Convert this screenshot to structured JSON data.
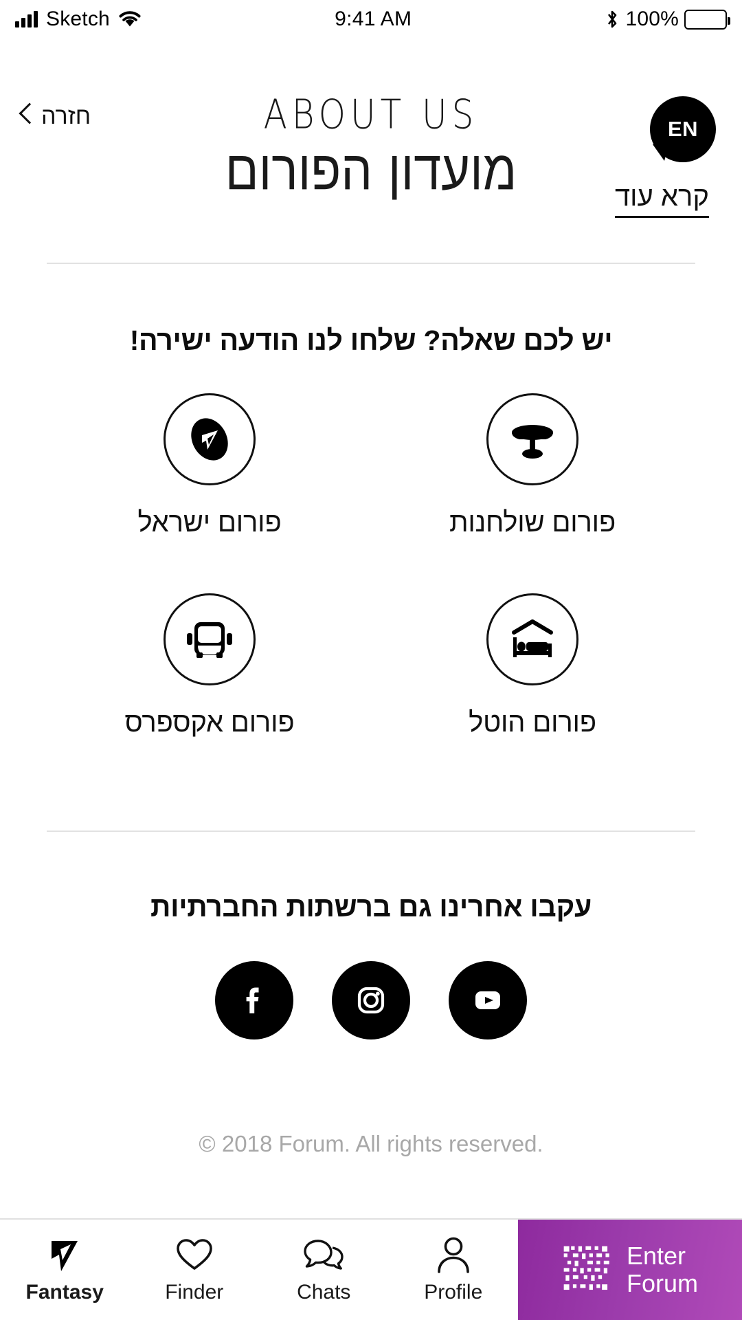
{
  "status_bar": {
    "carrier": "Sketch",
    "time": "9:41 AM",
    "battery_percent": "100%",
    "signal_icon": "signal-bars-icon",
    "wifi_icon": "wifi-icon",
    "bluetooth_icon": "bluetooth-icon",
    "battery_icon": "battery-full-icon"
  },
  "header": {
    "back_label": "חזרה",
    "back_icon": "chevron-left-icon",
    "title_en": "ABOUT US",
    "title_he": "מועדון הפורום",
    "language_badge": "EN",
    "read_more": "קרא עוד"
  },
  "forums_section": {
    "title": "יש לכם שאלה? שלחו לנו הודעה ישירה!",
    "items": [
      {
        "label": "פורום שולחנות",
        "icon": "table-icon"
      },
      {
        "label": "פורום ישראל",
        "icon": "forum-israel-logo-icon"
      },
      {
        "label": "פורום הוטל",
        "icon": "bed-hotel-icon"
      },
      {
        "label": "פורום אקספרס",
        "icon": "bus-icon"
      }
    ]
  },
  "social_section": {
    "title": "עקבו אחרינו גם ברשתות החברתיות",
    "items": [
      {
        "name": "facebook",
        "icon": "facebook-icon"
      },
      {
        "name": "instagram",
        "icon": "instagram-icon"
      },
      {
        "name": "youtube",
        "icon": "youtube-icon"
      }
    ]
  },
  "footer": {
    "copyright": "© 2018 Forum. All rights reserved."
  },
  "tabbar": {
    "tabs": [
      {
        "label": "Fantasy",
        "icon": "fantasy-logo-icon",
        "active": true
      },
      {
        "label": "Finder",
        "icon": "heart-icon",
        "active": false
      },
      {
        "label": "Chats",
        "icon": "chat-bubbles-icon",
        "active": false
      },
      {
        "label": "Profile",
        "icon": "person-icon",
        "active": false
      }
    ],
    "cta": {
      "line1": "Enter",
      "line2": "Forum",
      "icon": "qr-code-icon"
    }
  },
  "colors": {
    "accent_purple_start": "#8e2a9e",
    "accent_purple_end": "#b04ab8",
    "text": "#111111",
    "muted": "#a8a8a8",
    "divider": "#e2e2e2"
  }
}
